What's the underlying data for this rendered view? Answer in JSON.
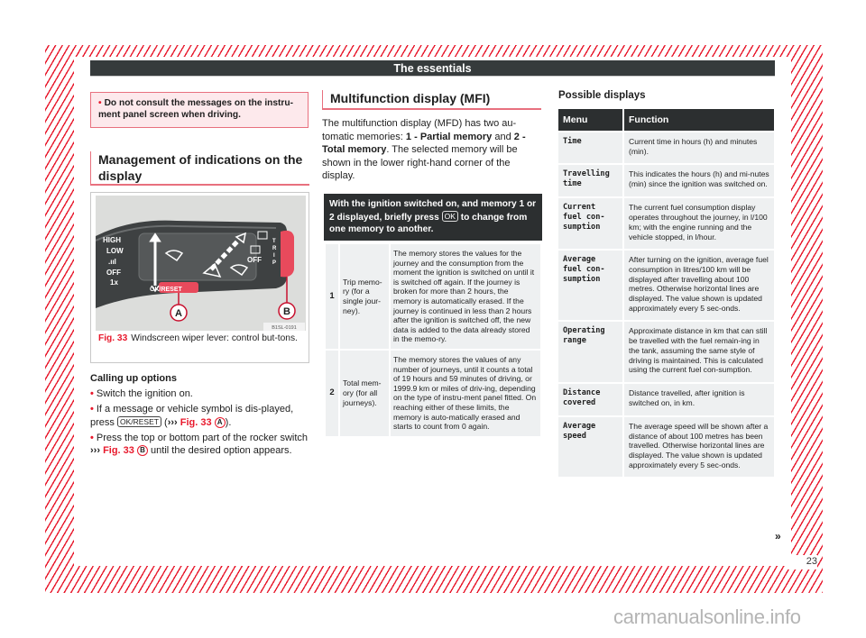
{
  "header": {
    "title": "The essentials"
  },
  "warning": {
    "bullet": "•",
    "text": "Do not consult the messages on the instru-ment panel screen when driving."
  },
  "section_management": {
    "title": "Management of indications on the display"
  },
  "figure": {
    "labels": {
      "high": "HIGH",
      "low": "LOW",
      "interval": ".ııl",
      "off_left": "OFF",
      "once": "1x",
      "off_right": "OFF",
      "trip": "TRIP",
      "ok_reset": "OK/RESET",
      "callout_a": "A",
      "callout_b": "B",
      "code": "B1SL-0191"
    },
    "caption_num": "Fig. 33",
    "caption_text": "Windscreen wiper lever: control but-tons."
  },
  "calling": {
    "title": "Calling up options",
    "items": [
      {
        "text": "Switch the ignition on."
      },
      {
        "pre": "If a message or vehicle symbol is dis-played, press",
        "key": "OK/RESET",
        "ref_open": "(",
        "arrow": "›››",
        "ref": "Fig. 33",
        "callout": "A",
        "ref_close": ")."
      },
      {
        "pre": "Press the top or bottom part of the rocker switch",
        "arrow": "›››",
        "ref": "Fig. 33",
        "callout": "B",
        "post": "until the desired option appears."
      }
    ]
  },
  "mfi": {
    "title": "Multifunction display (MFI)",
    "intro_a": "The multifunction display (MFD) has two au-tomatic memories: ",
    "intro_b": "1 - Partial memory",
    "intro_c": " and ",
    "intro_d": "2 - Total memory",
    "intro_e": ". The selected memory will be shown in the lower right-hand corner of the display.",
    "box_a": "With the ignition switched on, and memory 1 or 2 displayed, briefly press",
    "box_key": "OK",
    "box_b": "to change from one memory to another.",
    "rows": [
      {
        "num": "1",
        "name": "Trip memo-ry (for a single jour-ney).",
        "desc": "The memory stores the values for the journey and the consumption from the moment the ignition is switched on until it is switched off again. If the journey is broken for more than 2 hours, the memory is automatically erased. If the journey is continued in less than 2 hours after the ignition is switched off, the new data is added to the data already stored in the memo-ry."
      },
      {
        "num": "2",
        "name": "Total mem-ory (for all journeys).",
        "desc": "The memory stores the values of any number of journeys, until it counts a total of 19 hours and 59 minutes of driving, or 1999.9 km or miles of driv-ing, depending on the type of instru-ment panel fitted. On reaching either of these limits, the memory is auto-matically erased and starts to count from 0 again."
      }
    ]
  },
  "displays": {
    "title": "Possible displays",
    "col_menu": "Menu",
    "col_function": "Function",
    "rows": [
      {
        "menu": "Time",
        "function": "Current time in hours (h) and minutes (min)."
      },
      {
        "menu": "Travelling time",
        "function": "This indicates the hours (h) and mi-nutes (min) since the ignition was switched on."
      },
      {
        "menu": "Current fuel con-sumption",
        "function": "The current fuel consumption display operates throughout the journey, in l/100 km; with the engine running and the vehicle stopped, in l/hour."
      },
      {
        "menu": "Average fuel con-sumption",
        "function": "After turning on the ignition, average fuel consumption in litres/100 km will be displayed after travelling about 100 metres. Otherwise horizontal lines are displayed. The value shown is updated approximately every 5 sec-onds."
      },
      {
        "menu": "Operating range",
        "function": "Approximate distance in km that can still be travelled with the fuel remain-ing in the tank, assuming the same style of driving is maintained. This is calculated using the current fuel con-sumption."
      },
      {
        "menu": "Distance covered",
        "function": "Distance travelled, after ignition is switched on, in km."
      },
      {
        "menu": "Average speed",
        "function": "The average speed will be shown after a distance of about 100 metres has been travelled. Otherwise horizontal lines are displayed. The value shown is updated approximately every 5 sec-onds."
      }
    ],
    "continue_mark": "»"
  },
  "page_number": "23",
  "watermark": "carmanualsonline.info",
  "colors": {
    "accent": "#e8192c",
    "dark": "#2c2f30",
    "cell": "#eef0f1"
  }
}
